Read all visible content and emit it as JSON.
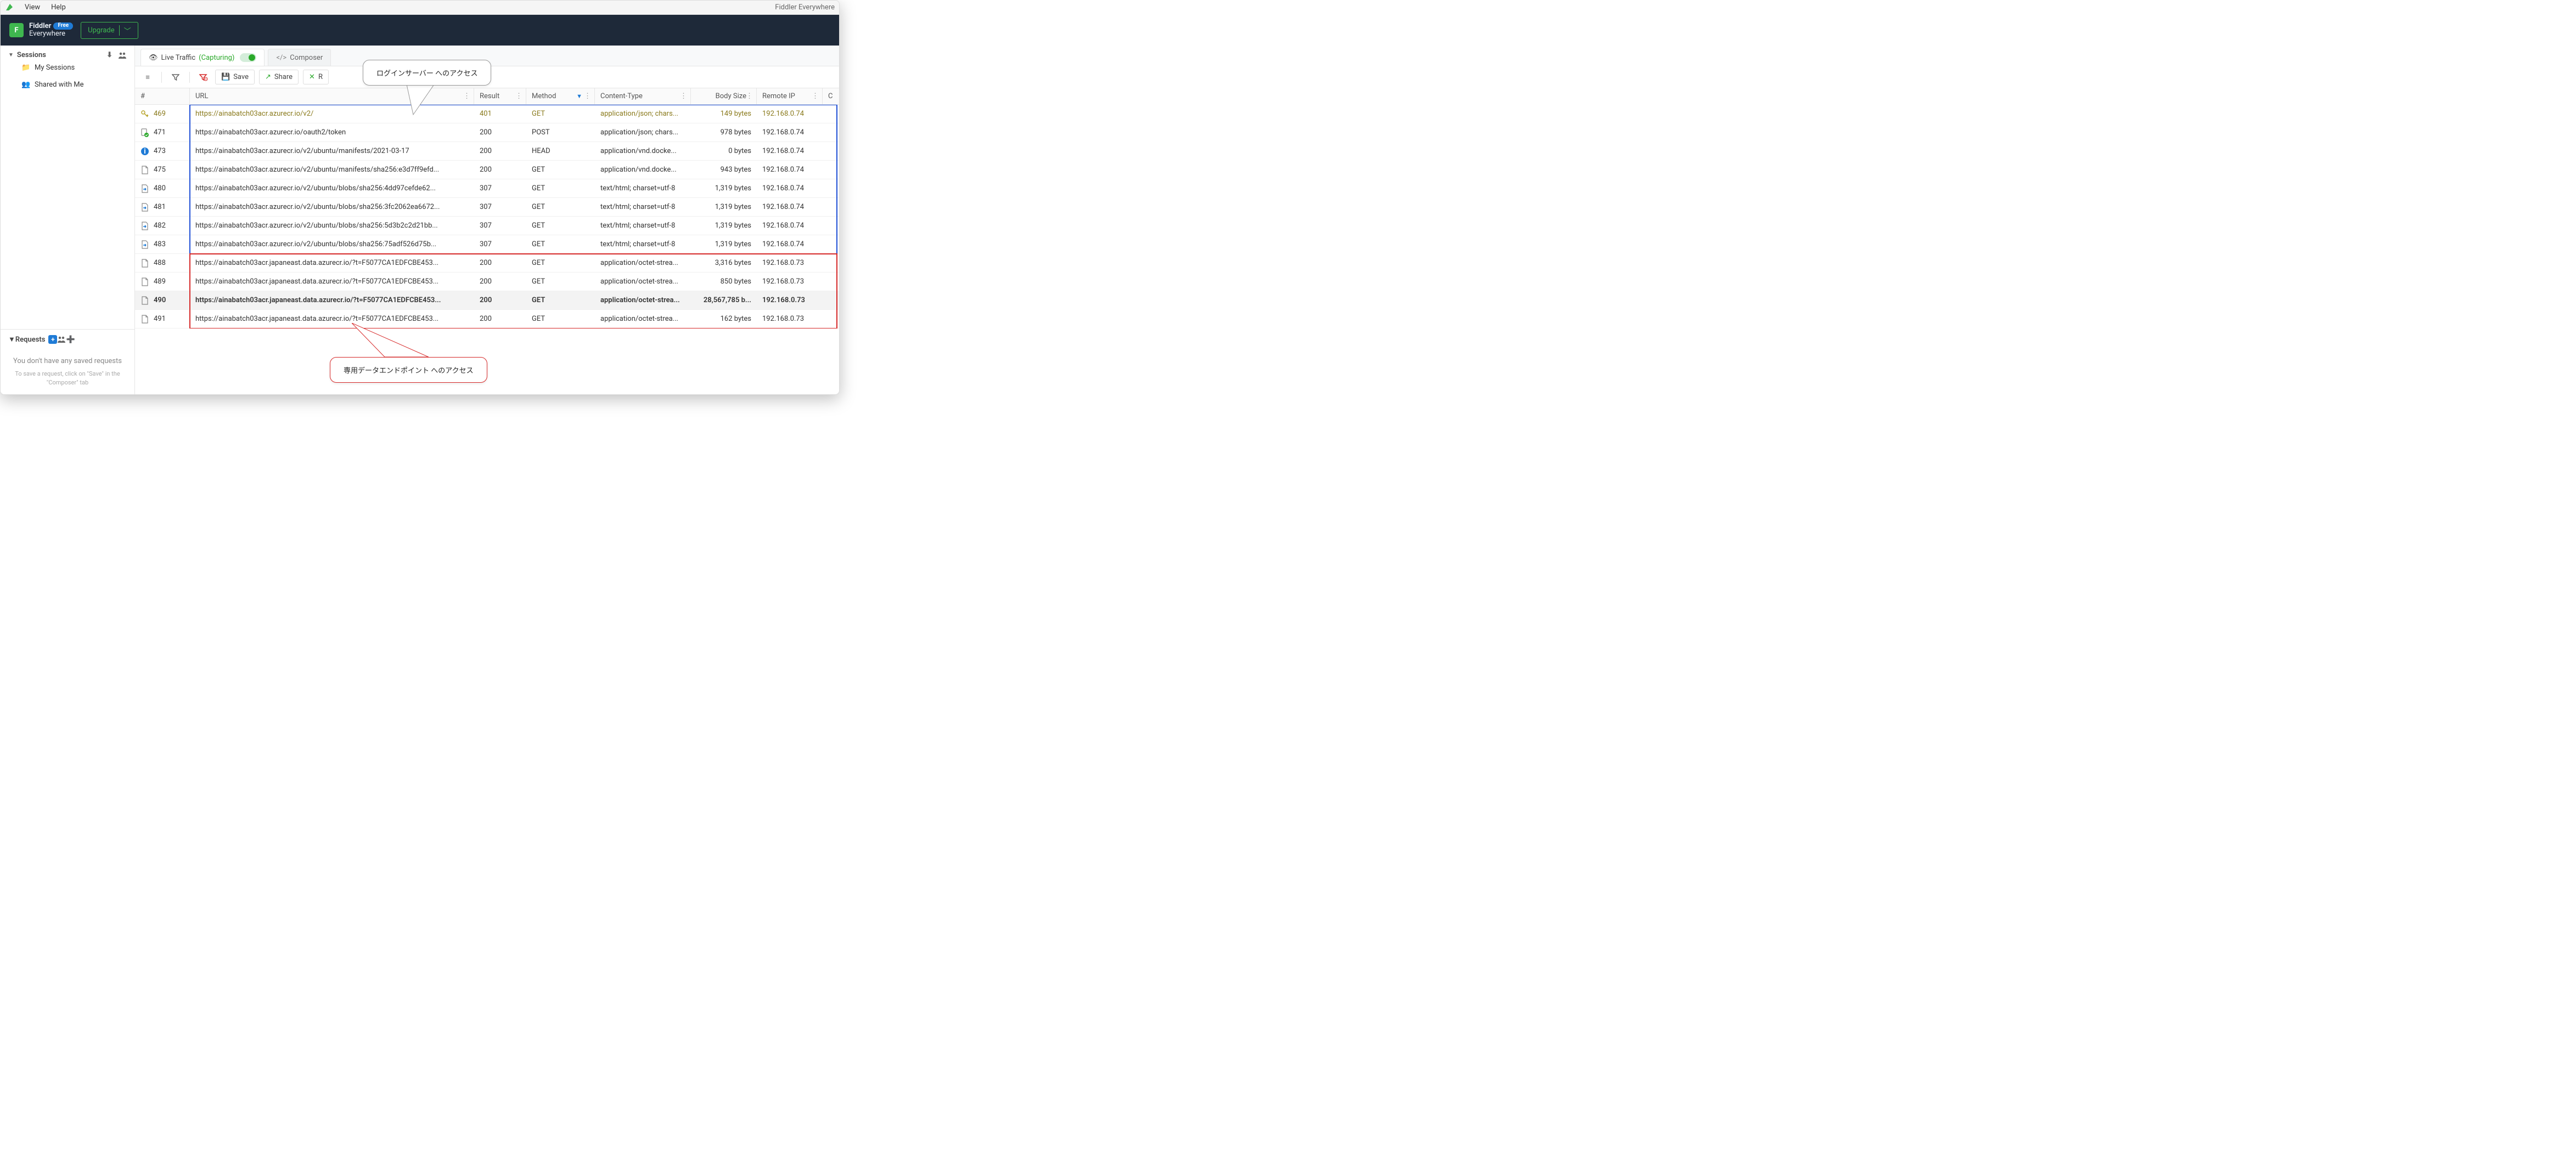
{
  "titlebar": {
    "menu": [
      "View",
      "Help"
    ],
    "title": "Fiddler Everywhere"
  },
  "brand": {
    "line1": "Fiddler",
    "line2": "Everywhere",
    "badge": "Free",
    "upgrade": "Upgrade"
  },
  "sidebar": {
    "sessions_label": "Sessions",
    "items": [
      {
        "icon": "folder-icon",
        "label": "My Sessions"
      },
      {
        "icon": "share-icon",
        "label": "Shared with Me"
      }
    ],
    "requests_label": "Requests",
    "empty_msg": "You don't have any saved requests",
    "empty_hint": "To save a request, click on \"Save\" in the \"Composer\" tab"
  },
  "tabs": {
    "live": "Live Traffic",
    "capturing": "(Capturing)",
    "composer": "Composer"
  },
  "toolbar": {
    "save": "Save",
    "share": "Share",
    "remove": "R"
  },
  "columns": {
    "hash": "#",
    "url": "URL",
    "result": "Result",
    "method": "Method",
    "ct": "Content-Type",
    "body": "Body Size",
    "ip": "Remote IP",
    "extra": "C"
  },
  "rows": [
    {
      "id": "469",
      "icon": "key",
      "url": "https://ainabatch03acr.azurecr.io/v2/",
      "result": "401",
      "method": "GET",
      "ct": "application/json; chars...",
      "body": "149 bytes",
      "ip": "192.168.0.74",
      "style": "gold",
      "group": "blue"
    },
    {
      "id": "471",
      "icon": "doc-ok",
      "url": "https://ainabatch03acr.azurecr.io/oauth2/token",
      "result": "200",
      "method": "POST",
      "ct": "application/json; chars...",
      "body": "978 bytes",
      "ip": "192.168.0.74",
      "group": "blue"
    },
    {
      "id": "473",
      "icon": "info",
      "url": "https://ainabatch03acr.azurecr.io/v2/ubuntu/manifests/2021-03-17",
      "result": "200",
      "method": "HEAD",
      "ct": "application/vnd.docke...",
      "body": "0 bytes",
      "ip": "192.168.0.74",
      "group": "blue"
    },
    {
      "id": "475",
      "icon": "doc",
      "url": "https://ainabatch03acr.azurecr.io/v2/ubuntu/manifests/sha256:e3d7ff9efd...",
      "result": "200",
      "method": "GET",
      "ct": "application/vnd.docke...",
      "body": "943 bytes",
      "ip": "192.168.0.74",
      "group": "blue"
    },
    {
      "id": "480",
      "icon": "redirect",
      "url": "https://ainabatch03acr.azurecr.io/v2/ubuntu/blobs/sha256:4dd97cefde62...",
      "result": "307",
      "method": "GET",
      "ct": "text/html; charset=utf-8",
      "body": "1,319 bytes",
      "ip": "192.168.0.74",
      "group": "blue"
    },
    {
      "id": "481",
      "icon": "redirect",
      "url": "https://ainabatch03acr.azurecr.io/v2/ubuntu/blobs/sha256:3fc2062ea6672...",
      "result": "307",
      "method": "GET",
      "ct": "text/html; charset=utf-8",
      "body": "1,319 bytes",
      "ip": "192.168.0.74",
      "group": "blue"
    },
    {
      "id": "482",
      "icon": "redirect",
      "url": "https://ainabatch03acr.azurecr.io/v2/ubuntu/blobs/sha256:5d3b2c2d21bb...",
      "result": "307",
      "method": "GET",
      "ct": "text/html; charset=utf-8",
      "body": "1,319 bytes",
      "ip": "192.168.0.74",
      "group": "blue"
    },
    {
      "id": "483",
      "icon": "redirect",
      "url": "https://ainabatch03acr.azurecr.io/v2/ubuntu/blobs/sha256:75adf526d75b...",
      "result": "307",
      "method": "GET",
      "ct": "text/html; charset=utf-8",
      "body": "1,319 bytes",
      "ip": "192.168.0.74",
      "group": "blue"
    },
    {
      "id": "488",
      "icon": "doc",
      "url": "https://ainabatch03acr.japaneast.data.azurecr.io/?t=F5077CA1EDFCBE453...",
      "result": "200",
      "method": "GET",
      "ct": "application/octet-strea...",
      "body": "3,316 bytes",
      "ip": "192.168.0.73",
      "group": "red"
    },
    {
      "id": "489",
      "icon": "doc",
      "url": "https://ainabatch03acr.japaneast.data.azurecr.io/?t=F5077CA1EDFCBE453...",
      "result": "200",
      "method": "GET",
      "ct": "application/octet-strea...",
      "body": "850 bytes",
      "ip": "192.168.0.73",
      "group": "red"
    },
    {
      "id": "490",
      "icon": "doc",
      "url": "https://ainabatch03acr.japaneast.data.azurecr.io/?t=F5077CA1EDFCBE453...",
      "result": "200",
      "method": "GET",
      "ct": "application/octet-strea...",
      "body": "28,567,785 b...",
      "ip": "192.168.0.73",
      "group": "red",
      "selected": true
    },
    {
      "id": "491",
      "icon": "doc",
      "url": "https://ainabatch03acr.japaneast.data.azurecr.io/?t=F5077CA1EDFCBE453...",
      "result": "200",
      "method": "GET",
      "ct": "application/octet-strea...",
      "body": "162 bytes",
      "ip": "192.168.0.73",
      "group": "red"
    }
  ],
  "callouts": {
    "top": "ログインサーバー へのアクセス",
    "bottom": "専用データエンドポイント へのアクセス"
  }
}
